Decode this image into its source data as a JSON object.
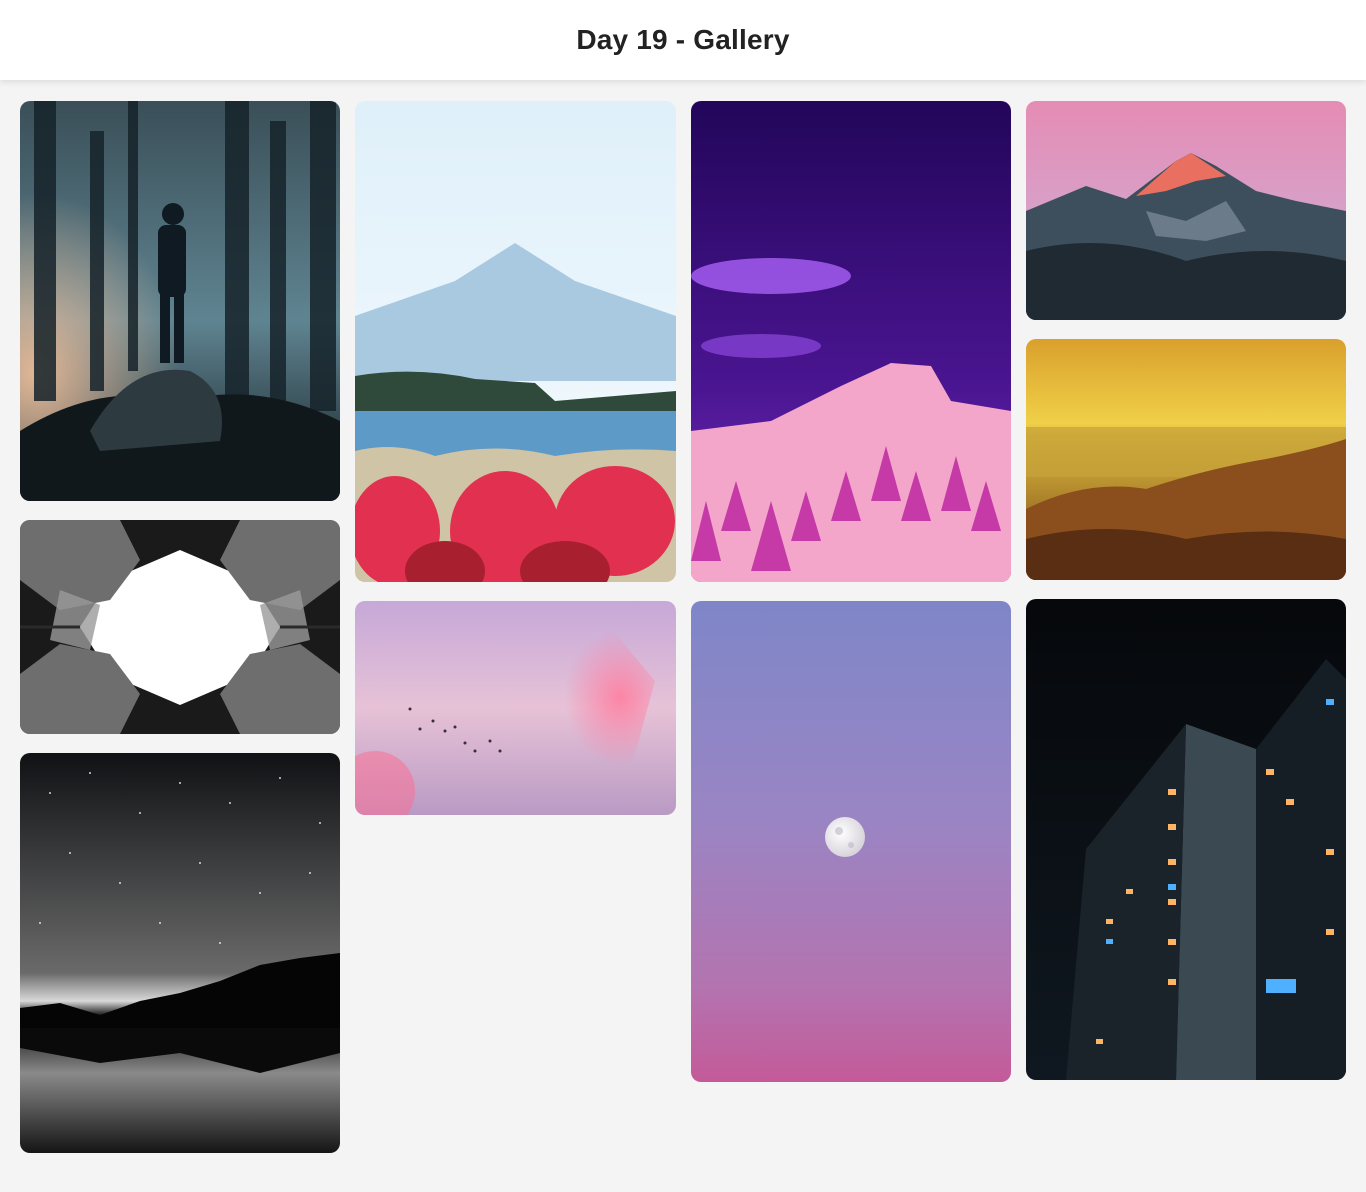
{
  "header": {
    "title": "Day 19 - Gallery"
  },
  "gallery": {
    "photos": [
      {
        "name": "forest-astronaut-photo",
        "colors": [
          "#1c2a33",
          "#6d8f9c",
          "#e7b59a"
        ]
      },
      {
        "name": "kaleidoscope-architecture-photo",
        "colors": [
          "#111111",
          "#777777",
          "#ffffff"
        ]
      },
      {
        "name": "starry-lake-photo",
        "colors": [
          "#0c0c0c",
          "#5a5a5a",
          "#cfcfcf"
        ]
      },
      {
        "name": "mount-fuji-lake-photo",
        "colors": [
          "#dcecf7",
          "#7eb3d6",
          "#e0304e"
        ]
      },
      {
        "name": "pink-sky-birds-photo",
        "colors": [
          "#c7a9d6",
          "#f0b6c8",
          "#ff6f93"
        ]
      },
      {
        "name": "purple-mountain-photo",
        "colors": [
          "#2b0a6b",
          "#8c2fd4",
          "#ff9cc6"
        ]
      },
      {
        "name": "moon-gradient-photo",
        "colors": [
          "#7e85c8",
          "#a47cbf",
          "#c95d9c"
        ]
      },
      {
        "name": "sunset-peak-photo",
        "colors": [
          "#d98bb0",
          "#2b3c4a",
          "#e07565"
        ]
      },
      {
        "name": "golden-sea-photo",
        "colors": [
          "#e9b83a",
          "#a9782a",
          "#5b2a12"
        ]
      },
      {
        "name": "night-building-photo",
        "colors": [
          "#07090c",
          "#1e2a33",
          "#ffb060"
        ]
      }
    ]
  }
}
